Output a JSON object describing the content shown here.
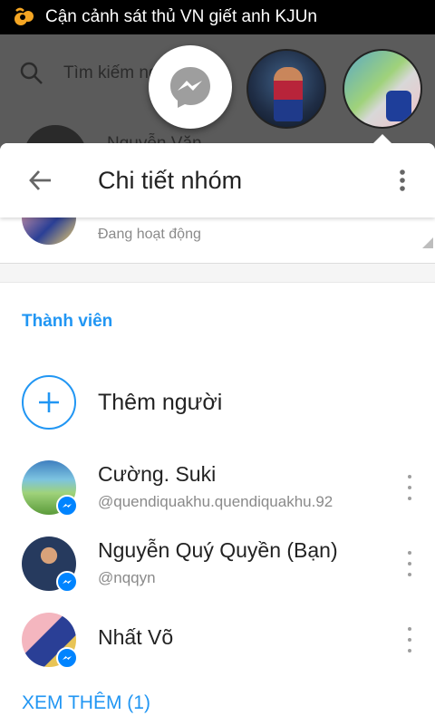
{
  "status_bar": {
    "notification_text": "Cận cảnh sát thủ VN giết anh KJUn",
    "app_icon": "uc-browser-icon"
  },
  "background": {
    "search_placeholder": "Tìm kiếm người",
    "partial_name": "Nguyễn Văn..."
  },
  "chat_heads": {
    "messenger_icon": "messenger-icon"
  },
  "toolbar": {
    "title": "Chi tiết nhóm",
    "back_icon": "arrow-back-icon",
    "more_icon": "more-vert-icon"
  },
  "group_status": "Đang hoạt động",
  "members_section": {
    "title": "Thành viên",
    "add_label": "Thêm người",
    "members": [
      {
        "name": "Cường. Suki",
        "handle": "@quendiquakhu.quendiquakhu.92"
      },
      {
        "name": "Nguyễn Quý Quyền (Bạn)",
        "handle": "@nqqyn"
      },
      {
        "name": "Nhất Võ",
        "handle": ""
      }
    ],
    "see_more": "XEM THÊM (1)"
  },
  "colors": {
    "accent": "#2196f3",
    "messenger_blue": "#0084ff"
  }
}
